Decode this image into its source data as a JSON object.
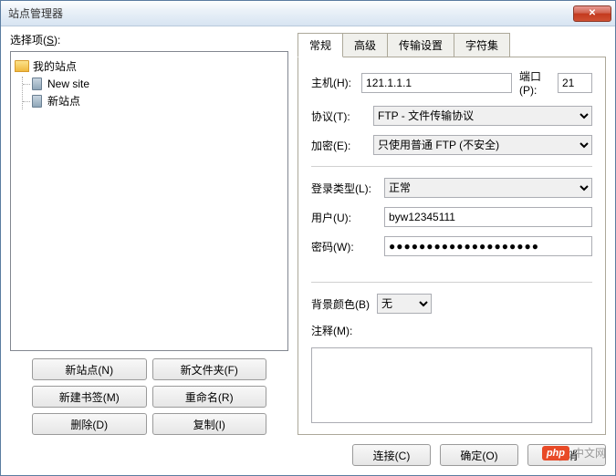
{
  "window": {
    "title": "站点管理器",
    "close_icon": "✕"
  },
  "left": {
    "select_label": "选择项",
    "select_key": "S",
    "tree": {
      "root": "我的站点",
      "items": [
        {
          "label": "New site"
        },
        {
          "label": "新站点"
        }
      ]
    },
    "buttons": {
      "new_site": "新站点(N)",
      "new_folder": "新文件夹(F)",
      "new_bookmark": "新建书签(M)",
      "rename": "重命名(R)",
      "delete": "删除(D)",
      "copy": "复制(I)"
    }
  },
  "tabs": {
    "general": "常规",
    "advanced": "高级",
    "transfer": "传输设置",
    "charset": "字符集"
  },
  "form": {
    "host_label": "主机(H):",
    "host_value": "121.1.1.1",
    "port_label": "端口(P):",
    "port_value": "21",
    "protocol_label": "协议(T):",
    "protocol_value": "FTP - 文件传输协议",
    "encryption_label": "加密(E):",
    "encryption_value": "只使用普通 FTP (不安全)",
    "logon_type_label": "登录类型(L):",
    "logon_type_value": "正常",
    "user_label": "用户(U):",
    "user_value": "byw12345111",
    "password_label": "密码(W):",
    "password_value": "●●●●●●●●●●●●●●●●●●●●",
    "bgcolor_label": "背景颜色(B)",
    "bgcolor_value": "无",
    "notes_label": "注释(M):",
    "notes_value": ""
  },
  "bottom": {
    "connect": "连接(C)",
    "ok": "确定(O)",
    "cancel": "取消"
  },
  "watermark": {
    "badge": "php",
    "text": "中文网"
  }
}
